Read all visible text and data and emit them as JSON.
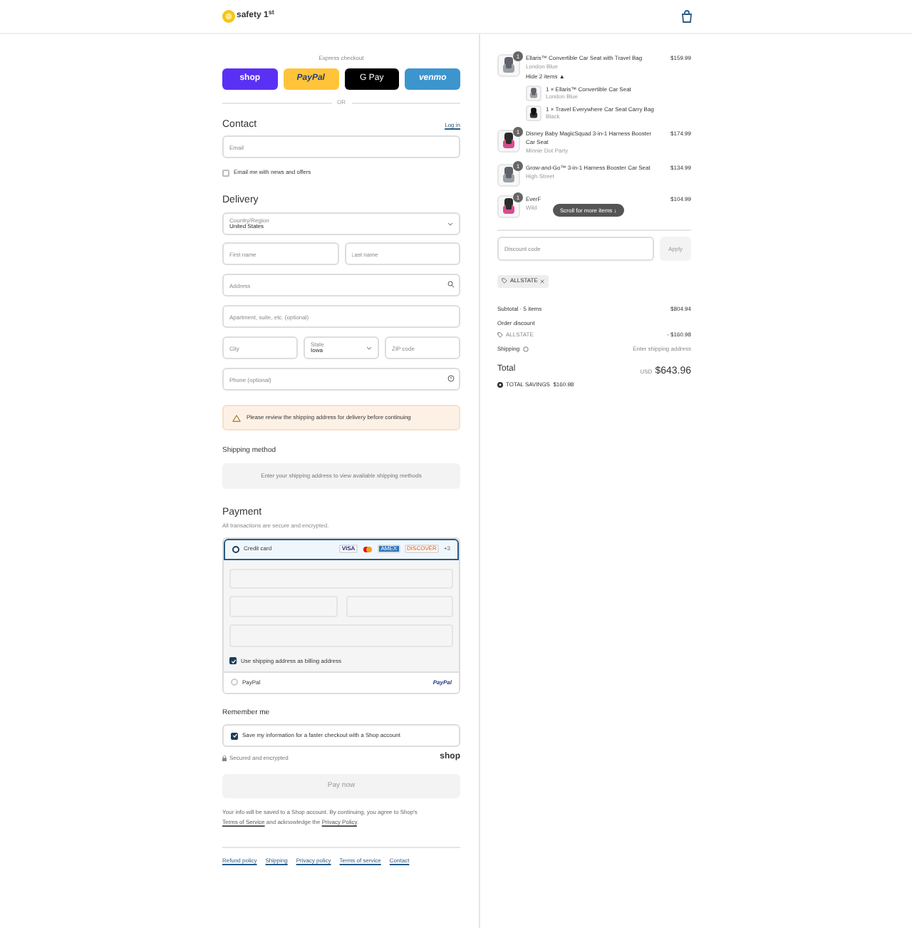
{
  "header": {
    "logo_text": "safety 1$^{st}$"
  },
  "express": {
    "title": "Express checkout",
    "buttons": [
      {
        "kind": "shop",
        "label": "shop"
      },
      {
        "kind": "paypal",
        "label": "PayPal"
      },
      {
        "kind": "gpay",
        "label": "G Pay"
      },
      {
        "kind": "venmo",
        "label": "venmo"
      }
    ],
    "divider": "OR"
  },
  "contact": {
    "title": "Contact",
    "login": "Log in",
    "email": {
      "placeholder": "Email"
    },
    "newsletter": {
      "label": "Email me with news and offers",
      "checked": false
    }
  },
  "delivery": {
    "title": "Delivery",
    "country": {
      "label": "Country/Region",
      "value": "United States"
    },
    "first_name": {
      "placeholder": "First name"
    },
    "last_name": {
      "placeholder": "Last name"
    },
    "address": {
      "placeholder": "Address"
    },
    "apartment": {
      "placeholder": "Apartment, suite, etc. (optional)"
    },
    "city": {
      "placeholder": "City"
    },
    "state": {
      "label": "State",
      "value": "Iowa"
    },
    "zip": {
      "placeholder": "ZIP code"
    },
    "phone": {
      "placeholder": "Phone (optional)"
    },
    "warning": "Please review the shipping address for delivery before continuing"
  },
  "shipping_method": {
    "title": "Shipping method",
    "message": "Enter your shipping address to view available shipping methods"
  },
  "payment": {
    "title": "Payment",
    "subtitle": "All transactions are secure and encrypted.",
    "methods": [
      {
        "kind": "card",
        "label": "Credit card",
        "selected": true,
        "brands": [
          {
            "kind": "visa",
            "label": "VISA"
          },
          {
            "kind": "mastercard"
          },
          {
            "kind": "amex",
            "label": "AMEX"
          },
          {
            "kind": "discover",
            "label": "DISCOVER"
          }
        ],
        "more": "+3",
        "billing": {
          "label": "Use shipping address as billing address",
          "checked": true
        }
      },
      {
        "kind": "paypal",
        "label": "PayPal",
        "logo": "PayPal",
        "selected": false
      }
    ]
  },
  "remember": {
    "title": "Remember me",
    "save": {
      "label": "Save my information for a faster checkout with a Shop account",
      "checked": true
    },
    "secured": "Secured and encrypted",
    "shop_logo": "shop"
  },
  "pay_button": "Pay now",
  "terms": "Your info will be saved to a Shop account. By continuing, you agree to Shop's ",
  "terms_link": "Terms of Service",
  "terms_mid": " and acknowledge the ",
  "privacy_link": "Privacy Policy",
  "terms_end": ".",
  "footer_links": [
    "Refund policy",
    "Shipping",
    "Privacy policy",
    "Terms of service",
    "Contact"
  ],
  "cart": {
    "items": [
      {
        "name": "Ellaris™ Convertible Car Seat with Travel Bag",
        "variant": "London Blue",
        "price": "$159.99",
        "quantity": "1",
        "kind": "grey",
        "toggle": "Hide 2 items ▲",
        "children": [
          {
            "name": "1 × Ellaris™ Convertible Car Seat",
            "variant": "London Blue",
            "kind": "grey"
          },
          {
            "name": "1 × Travel Everywhere Car Seat Carry Bag",
            "variant": "Black",
            "kind": "black"
          }
        ]
      },
      {
        "name": "Disney Baby MagicSquad 3-in-1 Harness Booster Car Seat",
        "variant": "Minnie Dot Party",
        "price": "$174.99",
        "quantity": "1",
        "kind": "pink"
      },
      {
        "name": "Grow-and-Go™ 3-in-1 Harness Booster Car Seat",
        "variant": "High Street",
        "price": "$134.99",
        "quantity": "1",
        "kind": "grey"
      },
      {
        "name": "EverF",
        "variant": "Wild",
        "price": "$104.99",
        "quantity": "1",
        "kind": "pink"
      }
    ],
    "scroll_hint": "Scroll for more items ↓",
    "discount_placeholder": "Discount code",
    "apply": "Apply",
    "tag": "ALLSTATE",
    "subtotal_label": "Subtotal · 5 items",
    "subtotal": "$804.94",
    "order_discount_label": "Order discount",
    "discount_code": "ALLSTATE",
    "discount_amount": "- $160.98",
    "shipping_label": "Shipping",
    "shipping_value": "Enter shipping address",
    "total_label": "Total",
    "currency": "USD",
    "total": "$643.96",
    "savings": "TOTAL SAVINGS  $160.98"
  }
}
